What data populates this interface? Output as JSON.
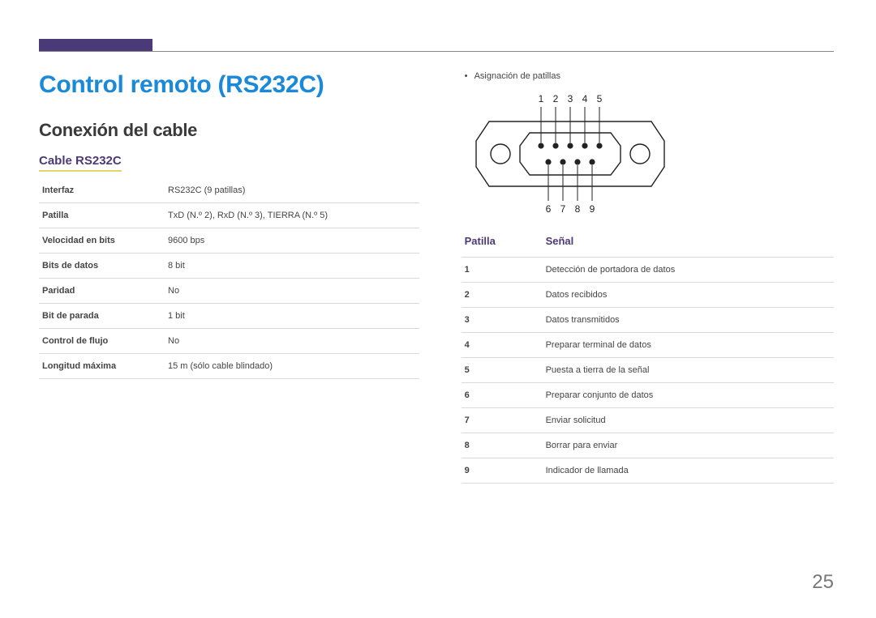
{
  "title": "Control remoto (RS232C)",
  "section": "Conexión del cable",
  "subsection": "Cable RS232C",
  "spec_table": {
    "rows": [
      {
        "k": "Interfaz",
        "v": "RS232C (9 patillas)"
      },
      {
        "k": "Patilla",
        "v": "TxD (N.º 2), RxD (N.º 3), TIERRA (N.º 5)"
      },
      {
        "k": "Velocidad en bits",
        "v": "9600 bps"
      },
      {
        "k": "Bits de datos",
        "v": "8 bit"
      },
      {
        "k": "Paridad",
        "v": "No"
      },
      {
        "k": "Bit de parada",
        "v": "1 bit"
      },
      {
        "k": "Control de flujo",
        "v": "No"
      },
      {
        "k": "Longitud máxima",
        "v": "15 m (sólo cable blindado)"
      }
    ]
  },
  "right": {
    "bullet": "Asignación de patillas",
    "diagram_labels_top": [
      "1",
      "2",
      "3",
      "4",
      "5"
    ],
    "diagram_labels_bottom": [
      "6",
      "7",
      "8",
      "9"
    ],
    "pin_header_col1": "Patilla",
    "pin_header_col2": "Señal",
    "pin_rows": [
      {
        "n": "1",
        "s": "Detección de portadora de datos"
      },
      {
        "n": "2",
        "s": "Datos recibidos"
      },
      {
        "n": "3",
        "s": "Datos transmitidos"
      },
      {
        "n": "4",
        "s": "Preparar terminal de datos"
      },
      {
        "n": "5",
        "s": "Puesta a tierra de la señal"
      },
      {
        "n": "6",
        "s": "Preparar conjunto de datos"
      },
      {
        "n": "7",
        "s": "Enviar solicitud"
      },
      {
        "n": "8",
        "s": "Borrar para enviar"
      },
      {
        "n": "9",
        "s": "Indicador de llamada"
      }
    ]
  },
  "page_number": "25"
}
